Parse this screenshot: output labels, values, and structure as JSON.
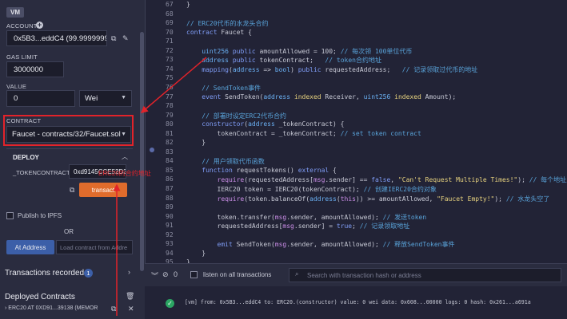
{
  "left_panel": {
    "vm_badge": "VM",
    "account_label": "ACCOUNT",
    "account_value": "0x5B3...eddC4 (99.9999999",
    "gas_limit_label": "GAS LIMIT",
    "gas_limit_value": "3000000",
    "value_label": "VALUE",
    "value_amount": "0",
    "value_unit": "Wei",
    "contract_label": "CONTRACT",
    "contract_selected": "Faucet - contracts/32/Faucet.sol",
    "deploy_title": "DEPLOY",
    "token_contract_label": "_TOKENCONTRACT:",
    "token_contract_value": "0xd9145CCE52D3",
    "transact_label": "transact",
    "publish_ipfs_label": "Publish to IPFS",
    "or_label": "OR",
    "at_address_label": "At Address",
    "load_contract_placeholder": "Load contract from Addre",
    "transactions_recorded_label": "Transactions recorded",
    "transactions_count": "1",
    "deployed_contracts_label": "Deployed Contracts",
    "deployed_item": "ERC20 AT 0XD91...39138 (MEMOR"
  },
  "annotation": {
    "text": "ERC20的合约地址",
    "color": "#e2232a"
  },
  "editor": {
    "lines": [
      {
        "num": "67",
        "html": "}"
      },
      {
        "num": "68",
        "html": ""
      },
      {
        "num": "69",
        "html": "<span class='cm'>// ERC20代币的水龙头合约</span>"
      },
      {
        "num": "70",
        "html": "<span class='kw'>contract</span> Faucet {"
      },
      {
        "num": "71",
        "html": ""
      },
      {
        "num": "72",
        "html": "    <span class='ty'>uint256</span> <span class='kw'>public</span> amountAllowed = 100; <span class='cm'>// 每次领 100单位代币</span>"
      },
      {
        "num": "73",
        "html": "    <span class='ty'>address</span> <span class='kw'>public</span> tokenContract;   <span class='cm'>// token合约地址</span>"
      },
      {
        "num": "74",
        "html": "    <span class='kw'>mapping</span>(<span class='ty'>address</span> => <span class='ty'>bool</span>) <span class='kw'>public</span> requestedAddress;   <span class='cm'>// 记录领取过代币的地址</span>"
      },
      {
        "num": "75",
        "html": ""
      },
      {
        "num": "76",
        "html": "    <span class='cm'>// SendToken事件</span>"
      },
      {
        "num": "77",
        "html": "    <span class='kw'>event</span> SendToken(<span class='ty'>address</span> <span class='st'>indexed</span> Receiver, <span class='ty'>uint256</span> <span class='st'>indexed</span> Amount);"
      },
      {
        "num": "78",
        "html": ""
      },
      {
        "num": "79",
        "html": "    <span class='cm'>// 部署时设定ERC2代币合约</span>"
      },
      {
        "num": "80",
        "html": "    <span class='kw'>constructor</span>(<span class='ty'>address</span> _tokenContract) {"
      },
      {
        "num": "81",
        "html": "        tokenContract = _tokenContract; <span class='cm'>// set token contract</span>"
      },
      {
        "num": "82",
        "html": "    }"
      },
      {
        "num": "83",
        "html": ""
      },
      {
        "num": "84",
        "html": "    <span class='cm'>// 用户领取代币函数</span>"
      },
      {
        "num": "85",
        "html": "    <span class='kw'>function</span> requestTokens() <span class='kw'>external</span> {"
      },
      {
        "num": "86",
        "html": "        <span class='msg'>require</span>(requestedAddress[<span class='msg'>msg</span>.sender] == <span class='kw'>false</span>, <span class='st'>\"Can't Request Multiple Times!\"</span>); <span class='cm'>// 每个地址只能领一次</span>"
      },
      {
        "num": "87",
        "html": "        IERC20 token = IERC20(tokenContract); <span class='cm'>// 创建IERC20合约对象</span>"
      },
      {
        "num": "88",
        "html": "        <span class='msg'>require</span>(token.balanceOf(<span class='ty'>address</span>(<span class='msg'>this</span>)) >= amountAllowed, <span class='st'>\"Faucet Empty!\"</span>); <span class='cm'>// 水龙头空了</span>"
      },
      {
        "num": "89",
        "html": ""
      },
      {
        "num": "90",
        "html": "        token.transfer(<span class='msg'>msg</span>.sender, amountAllowed); <span class='cm'>// 发送token</span>"
      },
      {
        "num": "91",
        "html": "        requestedAddress[<span class='msg'>msg</span>.sender] = <span class='kw'>true</span>; <span class='cm'>// 记录领取地址</span>"
      },
      {
        "num": "92",
        "html": ""
      },
      {
        "num": "93",
        "html": "        <span class='kw'>emit</span> SendToken(<span class='msg'>msg</span>.sender, amountAllowed); <span class='cm'>// 释放SendToken事件</span>"
      },
      {
        "num": "94",
        "html": "    }"
      },
      {
        "num": "95",
        "html": "}"
      }
    ]
  },
  "terminal": {
    "count": "0",
    "listen_label": "listen on all transactions",
    "search_placeholder": "Search with transaction hash or address",
    "log_line": "[vm]  from: 0x5B3...eddC4 to: ERC20.(constructor) value: 0 wei data: 0x608...00000 logs: 0 hash: 0x261...a691a"
  },
  "icons": {
    "copy": "copy-icon",
    "edit": "edit-icon",
    "plus": "plus-icon",
    "trash": "trash-icon",
    "search": "search-icon",
    "check": "check-icon"
  },
  "colors": {
    "accent_red": "#e2232a",
    "transact_orange": "#e06c2c",
    "at_address_blue": "#3c5fa8",
    "success_green": "#2ba663"
  }
}
